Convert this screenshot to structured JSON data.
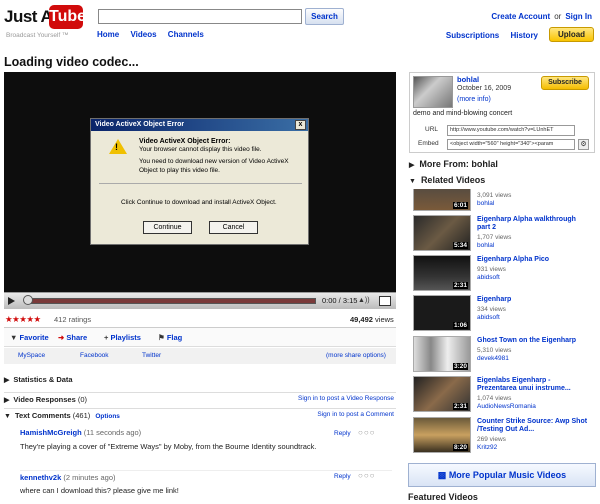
{
  "logo": {
    "word": "Just A",
    "tube": "Tube",
    "tagline": "Broadcast Yourself ™"
  },
  "search": {
    "value": "",
    "button": "Search"
  },
  "top_nav": [
    "Home",
    "Videos",
    "Channels"
  ],
  "account": {
    "create": "Create Account",
    "or": "or",
    "signin": "Sign In"
  },
  "nav2": [
    "Subscriptions",
    "History"
  ],
  "upload": "Upload",
  "page_title": "Loading video codec...",
  "player": {
    "time": "0:00 / 3:15",
    "progress_fraction": 0.0
  },
  "dialog": {
    "title": "Video ActiveX Object Error",
    "close": "x",
    "heading": "Video ActiveX Object Error:",
    "line1": "Your browser cannot display this video file.",
    "line2": "You need to download new version of Video ActiveX Object to play this video file.",
    "line3": "Click Continue to download and install ActiveX Object.",
    "continue": "Continue",
    "cancel": "Cancel"
  },
  "rating": {
    "stars": "★★★★★",
    "count": "412 ratings",
    "views_num": "49,492",
    "views_label": "views"
  },
  "actions": {
    "favorite": "Favorite",
    "share": "Share",
    "playlists": "Playlists",
    "flag": "Flag"
  },
  "share": {
    "myspace": "MySpace",
    "facebook": "Facebook",
    "twitter": "Twitter",
    "more": "(more share options)"
  },
  "sections": {
    "stats": "Statistics & Data",
    "responses": "Video Responses",
    "responses_count": "(0)",
    "responses_link": "Sign in to post a Video Response",
    "comments": "Text Comments",
    "comments_count": "(461)",
    "options": "Options",
    "comments_link": "Sign in to post a Comment"
  },
  "comments": [
    {
      "user": "HamishMcGreigh",
      "time": "(11 seconds ago)",
      "text": "They're playing a cover of \"Extreme Ways\" by Moby, from the Bourne Identity soundtrack.",
      "reply": "Reply"
    },
    {
      "user": "kennethv2k",
      "time": "(2 minutes ago)",
      "text": "where can I download this? please give me link!",
      "reply": "Reply"
    }
  ],
  "channel": {
    "name": "bohlal",
    "date": "October 16, 2009",
    "more": "(more info)",
    "desc": "demo and mind-blowing concert",
    "subscribe": "Subscribe",
    "url_label": "URL",
    "url_value": "http://www.youtube.com/watch?v=LUnhET",
    "embed_label": "Embed",
    "embed_value": "<object width=\"560\" height=\"340\"><param"
  },
  "more_from": "More From: bohlal",
  "related_title": "Related Videos",
  "related": [
    {
      "title": "",
      "views": "3,091 views",
      "user": "bohlal",
      "dur": "6:01"
    },
    {
      "title": "Eigenharp Alpha walkthrough part 2",
      "views": "1,707 views",
      "user": "bohlal",
      "dur": "5:34"
    },
    {
      "title": "Eigenharp Alpha Pico",
      "views": "931 views",
      "user": "abidsoft",
      "dur": "2:31"
    },
    {
      "title": "Eigenharp",
      "views": "334 views",
      "user": "abidsoft",
      "dur": "1:06"
    },
    {
      "title": "Ghost Town on the Eigenharp",
      "views": "5,310 views",
      "user": "devek4981",
      "dur": "3:20"
    },
    {
      "title": "Eigenlabs Eigenharp - Prezentarea unui instrume...",
      "views": "1,074 views",
      "user": "AudioNewsRomania",
      "dur": "2:31"
    },
    {
      "title": "Counter Strike Source: Awp Shot /Testing Out Ad...",
      "views": "269 views",
      "user": "Kritz92",
      "dur": "8:20"
    }
  ],
  "more_popular": "More Popular Music Videos",
  "featured": "Featured Videos",
  "colors": {
    "brand_red": "#d10b0b",
    "link_blue": "#0033cc",
    "upload_yellow": "#f9c400"
  }
}
